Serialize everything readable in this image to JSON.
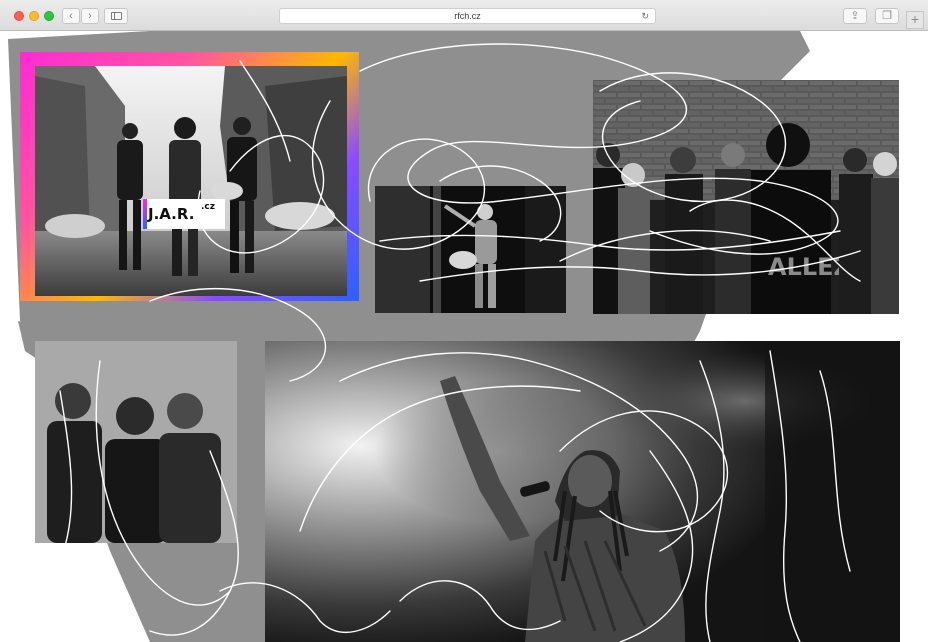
{
  "browser": {
    "url": "rfch.cz",
    "back_icon": "chevron-left-icon",
    "forward_icon": "chevron-right-icon",
    "reload_icon": "reload-icon",
    "share_icon": "share-icon",
    "tabs_icon": "tabs-icon",
    "new_tab_icon": "plus-icon"
  },
  "gallery": {
    "logo": {
      "name": "J.A.R.",
      "tld": "cz"
    },
    "colors": {
      "frame_start": "#ff2ad4",
      "frame_mid": "#ffb800",
      "frame_end": "#2a62ff",
      "shape_gray": "#8f8f8f"
    }
  }
}
